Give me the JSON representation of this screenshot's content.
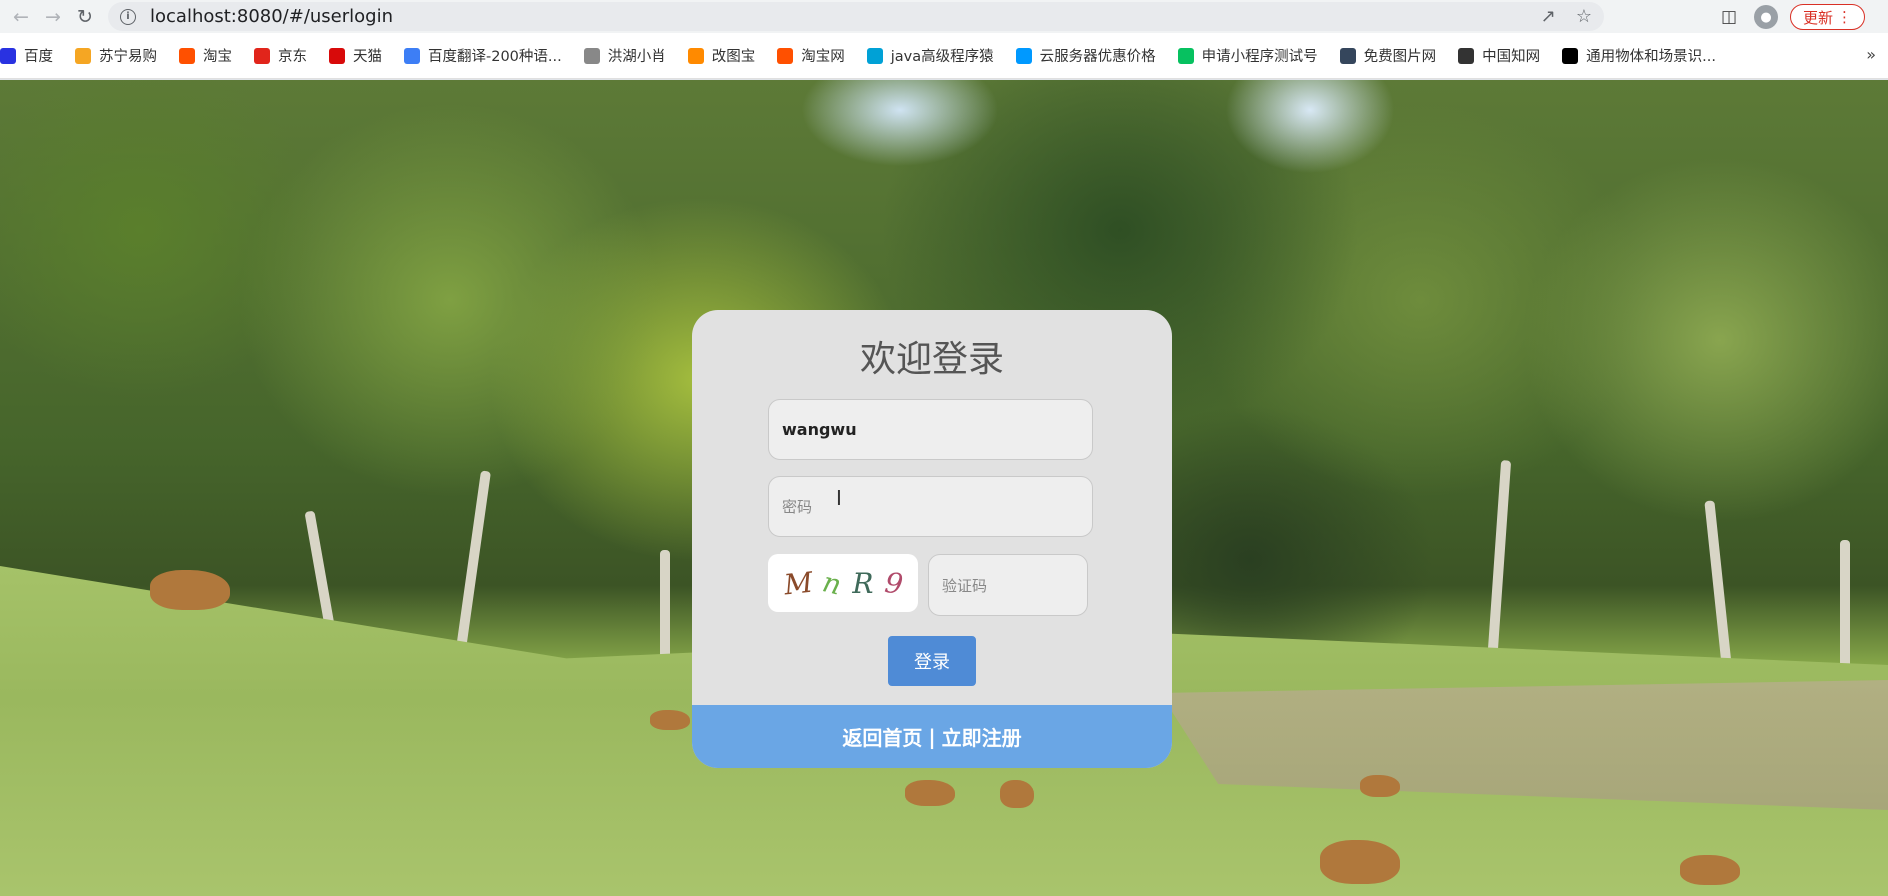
{
  "browser": {
    "url": "localhost:8080/#/userlogin",
    "update_label": "更新",
    "more_bookmarks": "»"
  },
  "bookmarks": [
    {
      "label": "百度",
      "icon": "baidu-icon",
      "color": "#2932e1"
    },
    {
      "label": "苏宁易购",
      "icon": "suning-icon",
      "color": "#f5a623"
    },
    {
      "label": "淘宝",
      "icon": "taobao-icon",
      "color": "#ff5000"
    },
    {
      "label": "京东",
      "icon": "jd-icon",
      "color": "#e1251b"
    },
    {
      "label": "天猫",
      "icon": "tmall-icon",
      "color": "#d80a0a"
    },
    {
      "label": "百度翻译-200种语...",
      "icon": "translate-icon",
      "color": "#3d7ef5"
    },
    {
      "label": "洪湖小肖",
      "icon": "bird-icon",
      "color": "#888888"
    },
    {
      "label": "改图宝",
      "icon": "gaitubao-icon",
      "color": "#ff8a00"
    },
    {
      "label": "淘宝网",
      "icon": "taobao-icon",
      "color": "#ff5000"
    },
    {
      "label": "java高级程序猿",
      "icon": "bilibili-icon",
      "color": "#00a1d6"
    },
    {
      "label": "云服务器优惠价格",
      "icon": "cloud-icon",
      "color": "#0099ff"
    },
    {
      "label": "申请小程序测试号",
      "icon": "wechat-icon",
      "color": "#07c160"
    },
    {
      "label": "免费图片网",
      "icon": "tumblr-icon",
      "color": "#35465c"
    },
    {
      "label": "中国知网",
      "icon": "cnki-icon",
      "color": "#333333"
    },
    {
      "label": "通用物体和场景识...",
      "icon": "ai-icon",
      "color": "#000000"
    }
  ],
  "login": {
    "title": "欢迎登录",
    "username_value": "wangwu",
    "password_placeholder": "密码",
    "captcha_chars": [
      "M",
      "n",
      "R",
      "9"
    ],
    "captcha_colors": [
      "#8a4a2a",
      "#6ab04c",
      "#3f6a5a",
      "#b04a6a"
    ],
    "code_placeholder": "验证码",
    "login_button": "登录",
    "back_home": "返回首页",
    "separator": "|",
    "register": "立即注册"
  }
}
